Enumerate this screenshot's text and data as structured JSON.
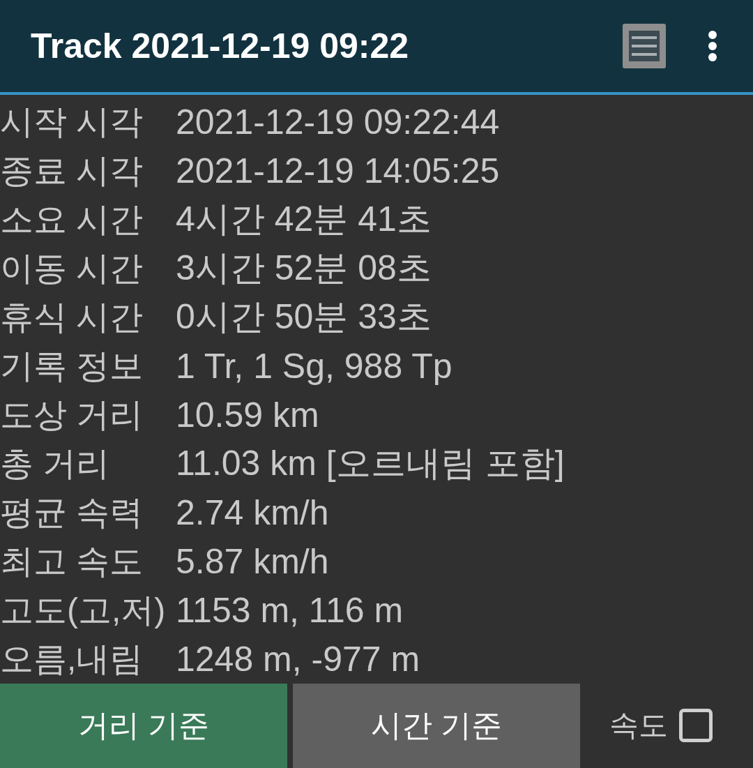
{
  "app_bar": {
    "title": "Track 2021-12-19 09:22"
  },
  "stats": [
    {
      "label": "시작 시각",
      "value": "2021-12-19 09:22:44"
    },
    {
      "label": "종료 시각",
      "value": "2021-12-19 14:05:25"
    },
    {
      "label": "소요 시간",
      "value": "4시간 42분 41초"
    },
    {
      "label": "이동 시간",
      "value": "3시간 52분 08초"
    },
    {
      "label": "휴식 시간",
      "value": "0시간 50분 33초"
    },
    {
      "label": "기록 정보",
      "value": "1 Tr, 1 Sg, 988 Tp"
    },
    {
      "label": "도상 거리",
      "value": "10.59 km"
    },
    {
      "label": "총 거리",
      "value": "11.03 km [오르내림 포함]"
    },
    {
      "label": "평균 속력",
      "value": "2.74 km/h"
    },
    {
      "label": "최고 속도",
      "value": "5.87 km/h"
    },
    {
      "label": "고도(고,저)",
      "value": "1153 m, 116 m"
    },
    {
      "label": "오름,내림",
      "value": "1248 m, -977 m"
    }
  ],
  "mode_buttons": [
    {
      "label": "거리 기준",
      "selected": true
    },
    {
      "label": "시간 기준",
      "selected": false
    }
  ],
  "speed_toggle": {
    "label": "속도",
    "checked": false
  }
}
